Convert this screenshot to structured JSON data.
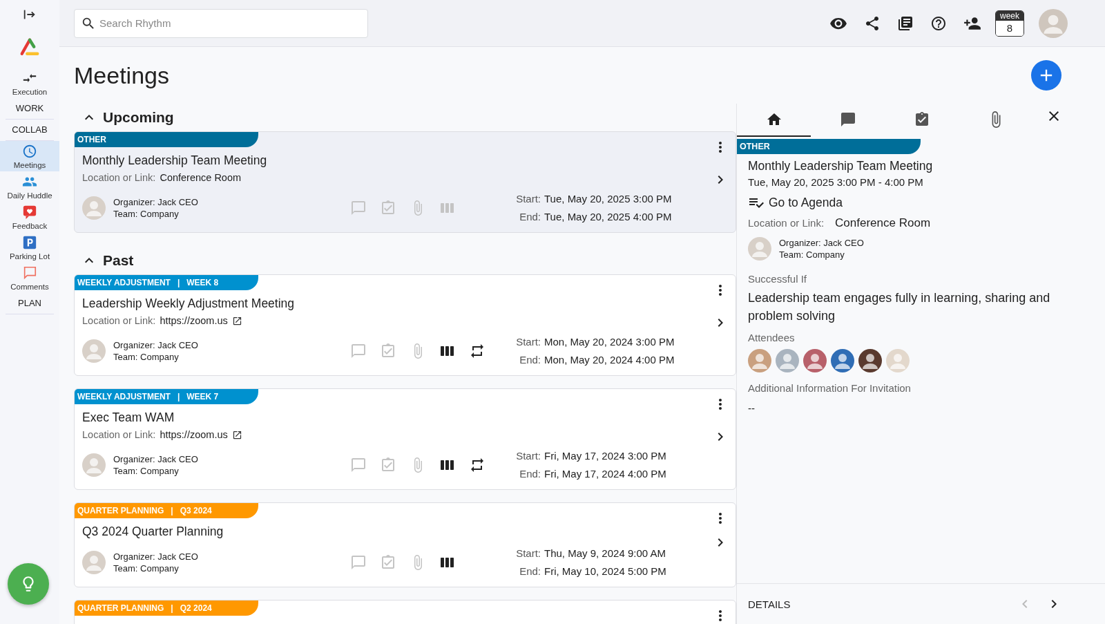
{
  "sidebar": {
    "items": [
      {
        "kind": "nav",
        "label": "Execution",
        "selected": false
      },
      {
        "kind": "section",
        "label": "WORK",
        "selected": false
      },
      {
        "kind": "section",
        "label": "COLLAB",
        "selected": false
      },
      {
        "kind": "nav",
        "label": "Meetings",
        "selected": true
      },
      {
        "kind": "nav",
        "label": "Daily Huddle",
        "selected": false
      },
      {
        "kind": "nav",
        "label": "Feedback",
        "selected": false
      },
      {
        "kind": "nav",
        "label": "Parking Lot",
        "selected": false
      },
      {
        "kind": "nav",
        "label": "Comments",
        "selected": false
      },
      {
        "kind": "section",
        "label": "PLAN",
        "selected": false
      }
    ]
  },
  "top_bar": {
    "search": {
      "placeholder": "Search Rhythm"
    },
    "week": {
      "label": "week",
      "value": "8"
    }
  },
  "page": {
    "title": "Meetings"
  },
  "sections": [
    {
      "title": "Upcoming",
      "expanded": true,
      "meetings": [
        {
          "color": "#006e99",
          "tag": "OTHER",
          "selected": true,
          "title": "Monthly Leadership Team Meeting",
          "location_label": "Location or Link:",
          "location": "Conference Room",
          "external_link": false,
          "organizer_label": "Organizer:",
          "organizer": "Jack CEO",
          "team_label": "Team:",
          "team": "Company",
          "agenda": false,
          "recurring": false,
          "start_label": "Start:",
          "start": "Tue, May 20, 2025 3:00 PM",
          "end_label": "End:",
          "end": "Tue, May 20, 2025 4:00 PM"
        }
      ]
    },
    {
      "title": "Past",
      "expanded": true,
      "meetings": [
        {
          "color": "#0091cf",
          "tag": "WEEKLY ADJUSTMENT   |   WEEK 8",
          "selected": false,
          "title": "Leadership Weekly Adjustment Meeting",
          "location_label": "Location or Link:",
          "location": "https://zoom.us",
          "external_link": true,
          "organizer_label": "Organizer:",
          "organizer": "Jack CEO",
          "team_label": "Team:",
          "team": "Company",
          "agenda": true,
          "recurring": true,
          "start_label": "Start:",
          "start": "Mon, May 20, 2024 3:00 PM",
          "end_label": "End:",
          "end": "Mon, May 20, 2024 4:00 PM"
        },
        {
          "color": "#0091cf",
          "tag": "WEEKLY ADJUSTMENT   |   WEEK 7",
          "selected": false,
          "title": "Exec Team WAM",
          "location_label": "Location or Link:",
          "location": "https://zoom.us",
          "external_link": true,
          "organizer_label": "Organizer:",
          "organizer": "Jack CEO",
          "team_label": "Team:",
          "team": "Company",
          "agenda": true,
          "recurring": true,
          "start_label": "Start:",
          "start": "Fri, May 17, 2024 3:00 PM",
          "end_label": "End:",
          "end": "Fri, May 17, 2024 4:00 PM"
        },
        {
          "color": "#ff9800",
          "tag": "QUARTER PLANNING   |   Q3 2024",
          "selected": false,
          "title": "Q3 2024 Quarter Planning",
          "organizer_label": "Organizer:",
          "organizer": "Jack CEO",
          "team_label": "Team:",
          "team": "Company",
          "agenda": true,
          "recurring": false,
          "start_label": "Start:",
          "start": "Thu, May 9, 2024 9:00 AM",
          "end_label": "End:",
          "end": "Fri, May 10, 2024 5:00 PM"
        },
        {
          "color": "#ff9800",
          "tag": "QUARTER PLANNING   |   Q2 2024",
          "selected": false
        }
      ]
    }
  ],
  "detail": {
    "tabs": [
      {
        "selected": true
      },
      {
        "selected": false
      },
      {
        "selected": false
      },
      {
        "selected": false
      }
    ],
    "color": "#006e99",
    "tag": "OTHER",
    "title": "Monthly Leadership Team Meeting",
    "datetime": "Tue, May 20, 2025 3:00 PM - 4:00 PM",
    "agenda_link": "Go to Agenda",
    "location_label": "Location or Link:",
    "location": "Conference Room",
    "organizer_label": "Organizer:",
    "organizer": "Jack CEO",
    "team_label": "Team:",
    "team": "Company",
    "success_label": "Successful If",
    "success_text": "Leadership team engages fully in learning, sharing and problem solving",
    "attendees_label": "Attendees",
    "attendees": [
      {
        "color": "#c9a07f"
      },
      {
        "color": "#a9b4bf"
      },
      {
        "color": "#b8606a"
      },
      {
        "color": "#2f6db5"
      },
      {
        "color": "#5a3a2e"
      },
      {
        "color": "#e3d8cc"
      }
    ],
    "additional_label": "Additional Information For Invitation",
    "additional_value": "--",
    "footer": {
      "label": "DETAILS",
      "prev_disabled": true,
      "next_disabled": false
    }
  }
}
